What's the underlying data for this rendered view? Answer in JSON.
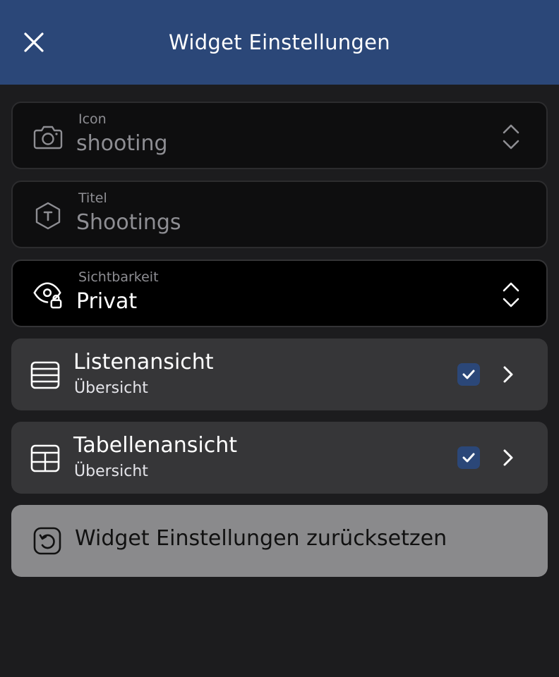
{
  "header": {
    "title": "Widget Einstellungen",
    "close_icon": "close-icon",
    "background": "#2b4778"
  },
  "fields": [
    {
      "label": "Icon",
      "value": "shooting",
      "icon": "camera-icon",
      "has_stepper": true
    },
    {
      "label": "Titel",
      "value": "Shootings",
      "icon": "title-hexagon-icon",
      "has_stepper": false
    },
    {
      "label": "Sichtbarkeit",
      "value": "Privat",
      "icon": "eye-lock-icon",
      "has_stepper": true
    }
  ],
  "views": [
    {
      "title": "Listenansicht",
      "subtitle": "Übersicht",
      "icon": "list-view-icon",
      "checked": true
    },
    {
      "title": "Tabellenansicht",
      "subtitle": "Übersicht",
      "icon": "table-view-icon",
      "checked": true
    }
  ],
  "reset": {
    "label": "Widget Einstellungen zurücksetzen",
    "icon": "reset-icon"
  },
  "colors": {
    "accent": "#2b4778",
    "row_bg": "#363638",
    "reset_bg": "#8a8a8c",
    "page_bg": "#1c1c1e"
  }
}
